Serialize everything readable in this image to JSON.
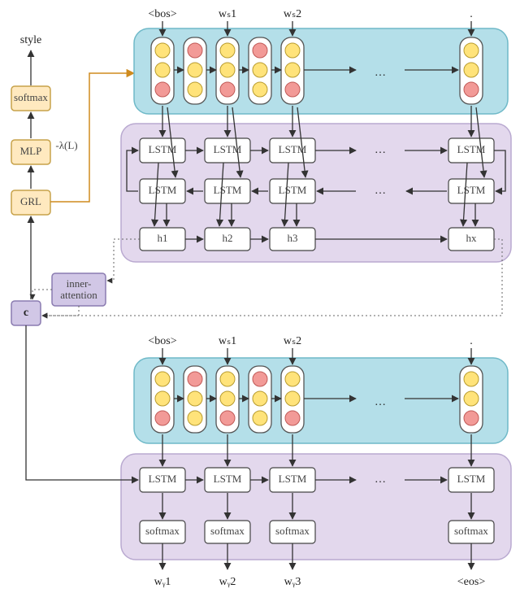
{
  "title": "style",
  "grl_stack": {
    "softmax": "softmax",
    "mlp": "MLP",
    "grl": "GRL",
    "lambda": "-λ(L)"
  },
  "context": {
    "c": "c",
    "attention": "inner-\nattention"
  },
  "encoder": {
    "inputs": [
      "<bos>",
      "wₛ1",
      "wₛ2",
      "."
    ],
    "lstm": "LSTM",
    "hidden": [
      "h1",
      "h2",
      "h3",
      "hx"
    ],
    "ellipsis": "…"
  },
  "decoder": {
    "inputs": [
      "<bos>",
      "wₛ1",
      "wₛ2",
      "."
    ],
    "lstm": "LSTM",
    "softmax": "softmax",
    "outputs": [
      "wᵧ1",
      "wᵧ2",
      "wᵧ3",
      "<eos>"
    ],
    "ellipsis": "…"
  },
  "colors": {
    "blue": "#b4dfe9",
    "purple": "#e3d8ed",
    "orange": "#ffe9bf",
    "ctx": "#d1c7e6"
  },
  "chart_data": {
    "type": "diagram",
    "description": "Seq2seq style-transfer architecture: bidirectional LSTM encoder with inner-attention producing context c fed through GRL→MLP→softmax for style prediction and into LSTM decoder with softmax output",
    "components": [
      "input-embeddings (traffic-light token embeddings)",
      "bidirectional-LSTM encoder (forward + backward rows) producing hidden states h1..hx",
      "inner-attention → context vector c",
      "adversarial branch c → GRL → MLP → softmax → style (gradient scaled by -λ(L))",
      "decoder LSTM conditioned on c and previous tokens, softmax outputs wᵧ1..wᵧ3,<eos>"
    ],
    "steps_shown": 4,
    "ellipsis_columns": true
  }
}
